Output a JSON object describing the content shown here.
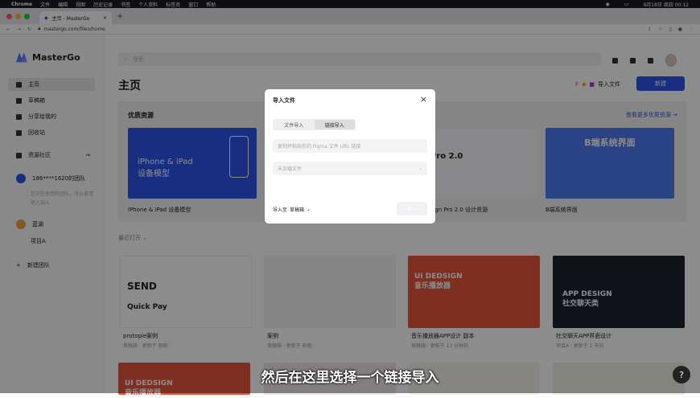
{
  "menubar": {
    "app": "Chrome",
    "items": [
      "文件",
      "编辑",
      "视图",
      "历史记录",
      "书签",
      "个人资料",
      "标签页",
      "窗口",
      "帮助"
    ],
    "clock": "6月18日 周四 00:12"
  },
  "browser": {
    "tab_title": "主页 - MasterGo",
    "new_tab": "+",
    "url": "mastergo.com/files/home"
  },
  "sidebar": {
    "logo": "MasterGo",
    "items": [
      {
        "label": "主页",
        "icon": "home-icon"
      },
      {
        "label": "草稿箱",
        "icon": "draft-icon"
      },
      {
        "label": "分享给我的",
        "icon": "share-icon"
      },
      {
        "label": "回收站",
        "icon": "trash-icon"
      },
      {
        "label": "资源社区",
        "icon": "community-icon"
      }
    ],
    "team1": {
      "name": "186****1620的团队",
      "note": "您正在使用的团队，可以邀请他人加入"
    },
    "team2": {
      "name": "蓝湖"
    },
    "project": "项目A",
    "new_team": "新建团队"
  },
  "main": {
    "search_placeholder": "搜索",
    "title": "主页",
    "import_label": "导入文件",
    "new_label": "新建",
    "resources_title": "优质资源",
    "resources_more": "查看更多优质资源 →",
    "resource_cards": [
      {
        "label": "iPhone & iPad 设备模型",
        "caption": "iPhone & iPad\n设备模型",
        "color": "#2f54eb"
      },
      {
        "label": "Design Pro 2.0 设计资源",
        "caption": "Pro 2.0",
        "color": "#f0f2f7"
      },
      {
        "label": "B端系统界面",
        "caption": "B端系统界面",
        "color": "#4d7bf3"
      }
    ],
    "recent_label": "最近打开",
    "recent": [
      {
        "title": "protopie案例",
        "sub": "草稿箱 · 更新于 刚刚",
        "send": "SEND",
        "quick": "Quick Pay"
      },
      {
        "title": "案例",
        "sub": "草稿箱 · 更新于 刚刚"
      },
      {
        "title": "音乐播放器APP设计 副本",
        "sub": "草稿箱 · 更新于 13 分钟前",
        "caption": "UI DEDSIGN\n音乐播放器"
      },
      {
        "title": "社交聊天APP界面设计",
        "sub": "项目A · 更新于 1 天前",
        "caption": "APP DESIGN\n社交聊天类"
      }
    ],
    "bottom_caption": "UI DEDSIGN\n音乐播放器"
  },
  "modal": {
    "title": "导入文件",
    "tabs": [
      "文件导入",
      "链接导入"
    ],
    "active_tab": 1,
    "url_placeholder": "复制并粘贴你的 Figma 文件 URL 链接",
    "select_placeholder": "未加载文件",
    "destination_label": "导入至",
    "destination_value": "草稿箱",
    "confirm_label": "导入"
  },
  "subtitle": "然后在这里选择一个链接导入",
  "help": "?"
}
